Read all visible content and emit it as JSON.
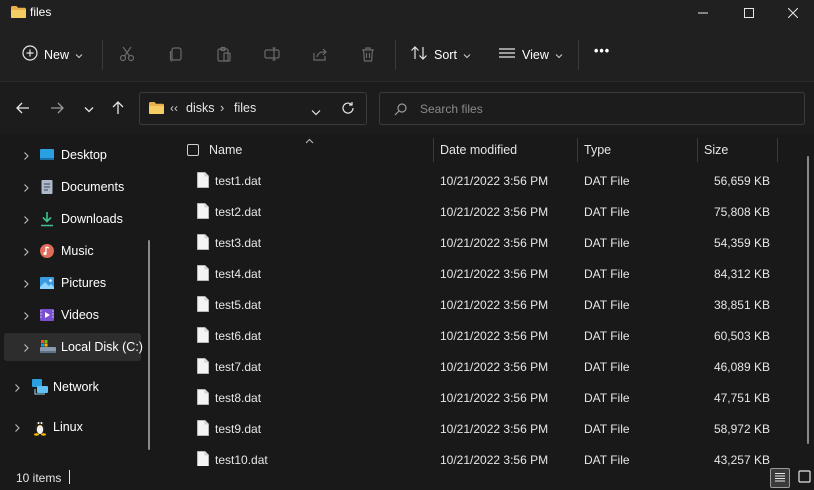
{
  "window": {
    "title": "files",
    "controls": [
      "minimize",
      "maximize",
      "close"
    ]
  },
  "toolbar": {
    "new_label": "New",
    "sort_label": "Sort",
    "view_label": "View",
    "more_label": "•••",
    "icons": [
      "plus-circle-icon",
      "cut-icon",
      "copy-icon",
      "paste-icon",
      "rename-icon",
      "share-icon",
      "delete-icon",
      "sort-icon",
      "view-icon",
      "more-icon"
    ]
  },
  "address": {
    "overflow": "‹‹",
    "crumbs": [
      "disks",
      "files"
    ],
    "separator": "›"
  },
  "search": {
    "placeholder": "Search files"
  },
  "sidebar": {
    "items": [
      {
        "label": "Desktop",
        "icon": "desktop-icon"
      },
      {
        "label": "Documents",
        "icon": "documents-icon"
      },
      {
        "label": "Downloads",
        "icon": "downloads-icon"
      },
      {
        "label": "Music",
        "icon": "music-icon"
      },
      {
        "label": "Pictures",
        "icon": "pictures-icon"
      },
      {
        "label": "Videos",
        "icon": "videos-icon"
      },
      {
        "label": "Local Disk (C:)",
        "icon": "drive-icon",
        "selected": true
      },
      {
        "label": "Network",
        "icon": "network-icon"
      },
      {
        "label": "Linux",
        "icon": "linux-icon"
      }
    ]
  },
  "columns": {
    "name": "Name",
    "date": "Date modified",
    "type": "Type",
    "size": "Size"
  },
  "files": [
    {
      "name": "test1.dat",
      "date": "10/21/2022 3:56 PM",
      "type": "DAT File",
      "size": "56,659 KB"
    },
    {
      "name": "test2.dat",
      "date": "10/21/2022 3:56 PM",
      "type": "DAT File",
      "size": "75,808 KB"
    },
    {
      "name": "test3.dat",
      "date": "10/21/2022 3:56 PM",
      "type": "DAT File",
      "size": "54,359 KB"
    },
    {
      "name": "test4.dat",
      "date": "10/21/2022 3:56 PM",
      "type": "DAT File",
      "size": "84,312 KB"
    },
    {
      "name": "test5.dat",
      "date": "10/21/2022 3:56 PM",
      "type": "DAT File",
      "size": "38,851 KB"
    },
    {
      "name": "test6.dat",
      "date": "10/21/2022 3:56 PM",
      "type": "DAT File",
      "size": "60,503 KB"
    },
    {
      "name": "test7.dat",
      "date": "10/21/2022 3:56 PM",
      "type": "DAT File",
      "size": "46,089 KB"
    },
    {
      "name": "test8.dat",
      "date": "10/21/2022 3:56 PM",
      "type": "DAT File",
      "size": "47,751 KB"
    },
    {
      "name": "test9.dat",
      "date": "10/21/2022 3:56 PM",
      "type": "DAT File",
      "size": "58,972 KB"
    },
    {
      "name": "test10.dat",
      "date": "10/21/2022 3:56 PM",
      "type": "DAT File",
      "size": "43,257 KB"
    }
  ],
  "status": {
    "item_count": "10 items"
  },
  "colors": {
    "background": "#191919",
    "chrome": "#202020",
    "folder_yellow": "#f2c55c",
    "text": "#e6e6e6"
  }
}
